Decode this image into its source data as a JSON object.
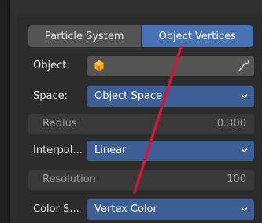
{
  "tabs": [
    {
      "label": "Particle System",
      "active": false
    },
    {
      "label": "Object Vertices",
      "active": true
    }
  ],
  "object": {
    "label": "Object:",
    "value": "",
    "icon": "orange-object-icon",
    "picker_icon": "eyedropper-icon"
  },
  "space": {
    "label": "Space:",
    "value": "Object Space"
  },
  "radius": {
    "label": "Radius",
    "value": "0.300"
  },
  "interpolation": {
    "label": "Interpol...",
    "value": "Linear"
  },
  "resolution": {
    "label": "Resolution",
    "value": "100"
  },
  "color_source": {
    "label": "Color S...",
    "value": "Vertex Color"
  },
  "colors": {
    "panel": "#2e2e2e",
    "active_tab": "#4772b3",
    "select_field": "#3d5f95",
    "annotation_line": "#d6153b",
    "object_icon": "#f5a623"
  }
}
